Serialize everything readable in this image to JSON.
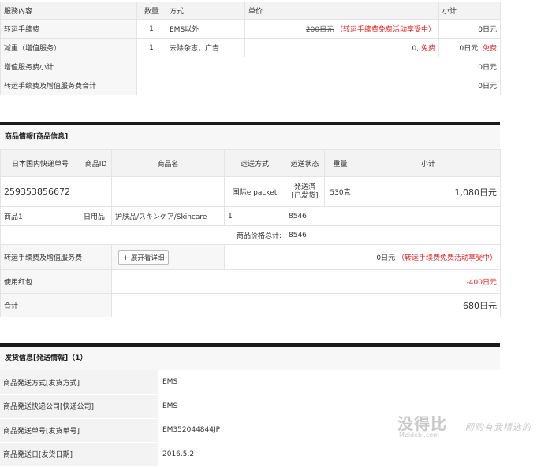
{
  "service_table": {
    "headers": [
      "服務內容",
      "数量",
      "方式",
      "单价",
      "小计"
    ],
    "rows": [
      {
        "name": "转运手续费",
        "qty": "1",
        "method": "EMS以外",
        "price_strike": "200日元",
        "price_note": "（转运手续费免费活动享受中）",
        "subtotal": "0日元"
      },
      {
        "name": "减重（增值服务）",
        "qty": "1",
        "method": "去除杂志，广告",
        "price_val": "0,",
        "price_free": "免费",
        "subtotal_val": "0日元,",
        "subtotal_free": "免费"
      }
    ],
    "subtotal_label": "增值服务费小计",
    "subtotal_value": "0日元",
    "total_label": "转运手续费及增值服务费合计",
    "total_value": "0日元"
  },
  "goods_section": {
    "title": "商品情報[商品信息]",
    "headers": [
      "日本国内快递单号",
      "商品ID",
      "商品名",
      "运送方式",
      "运送状态",
      "重量",
      "小计"
    ],
    "tracking_no": "259353856672",
    "ship_method": "国际e packet",
    "ship_status_line1": "発送済",
    "ship_status_line2": "[已发货]",
    "weight": "530克",
    "row_subtotal": "1,080日元",
    "item": {
      "id": "商品1",
      "category": "日用品",
      "name": "护肤品/スキンケア/Skincare",
      "qty": "1",
      "price": "8546"
    },
    "total_price_label": "商品价格总计:",
    "total_price": "8546",
    "fee_label": "转运手续费及增值服务费",
    "detail_button": "+ 展开看详细",
    "fee_value": "0日元",
    "fee_note": "（转运手续费免费活动享受中）",
    "coupon_label": "使用红包",
    "coupon_value": "-400日元",
    "grand_total_label": "合计",
    "grand_total_value": "680日元"
  },
  "shipping_section": {
    "title": "发货信息[発送情報]（1）",
    "rows": [
      {
        "label": "商品発送方式[发货方式]",
        "value": "EMS"
      },
      {
        "label": "商品発送快递公司[快递公司]",
        "value": "EMS"
      },
      {
        "label": "商品発送单号[发货单号]",
        "value": "EM352044844JP"
      },
      {
        "label": "商品発送日[发货日期]",
        "value": "2016.5.2"
      }
    ]
  },
  "watermark": {
    "logo": "没得比",
    "sub": "Meidebi.com",
    "slogan": "网购有我精选的"
  }
}
